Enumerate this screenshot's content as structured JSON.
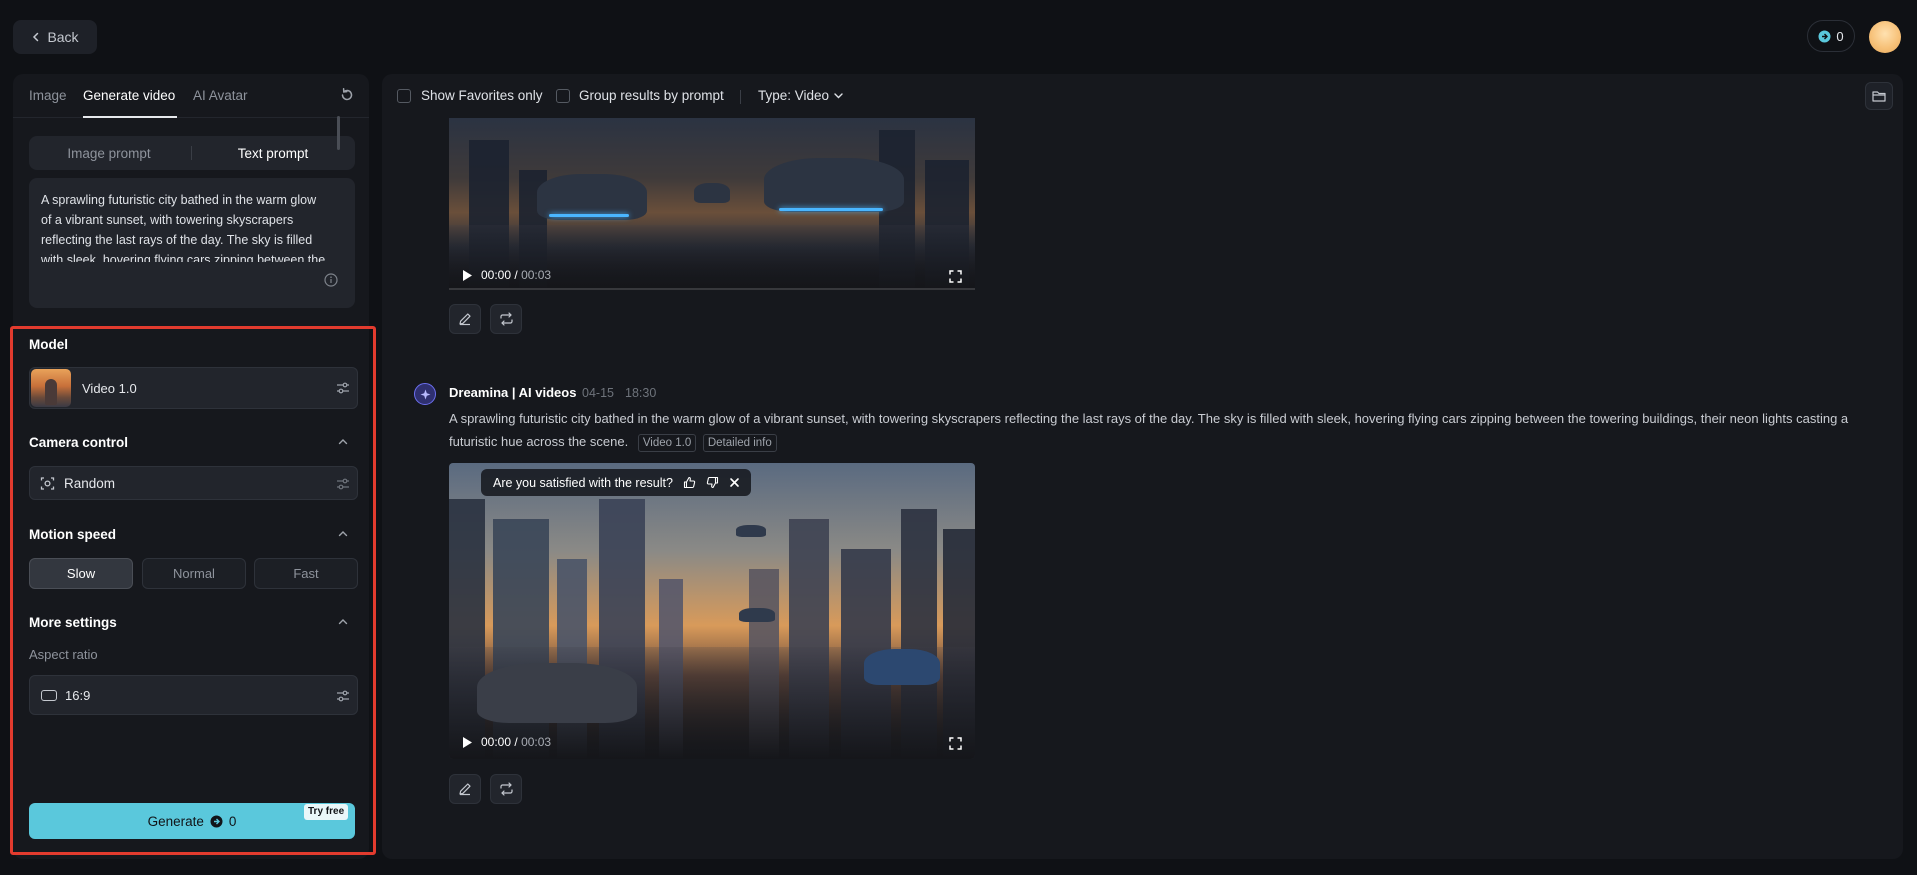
{
  "header": {
    "back_label": "Back",
    "credits": "0"
  },
  "left": {
    "tabs": [
      {
        "label": "Image"
      },
      {
        "label": "Generate video"
      },
      {
        "label": "AI Avatar"
      }
    ],
    "prompt_modes": {
      "image": "Image prompt",
      "text": "Text prompt"
    },
    "prompt_text": "A sprawling futuristic city bathed in the warm glow of a vibrant sunset, with towering skyscrapers reflecting the last rays of the day. The sky is filled with sleek, hovering flying cars zipping between the towering buildings, their neon lights casting a futuristic hue across the scene.",
    "model": {
      "title": "Model",
      "value": "Video 1.0"
    },
    "camera": {
      "title": "Camera control",
      "value": "Random"
    },
    "motion": {
      "title": "Motion speed",
      "options": [
        "Slow",
        "Normal",
        "Fast"
      ],
      "selected": "Slow"
    },
    "more": {
      "title": "More settings",
      "aspect_label": "Aspect ratio",
      "aspect_value": "16:9"
    },
    "generate": {
      "label": "Generate",
      "cost": "0",
      "badge": "Try free"
    }
  },
  "toolbar": {
    "favorites_label": "Show Favorites only",
    "group_label": "Group results by prompt",
    "type_label": "Type: Video"
  },
  "results": {
    "video1": {
      "time_current": "00:00",
      "time_sep": "/",
      "time_total": "00:03"
    },
    "message": {
      "author": "Dreamina | AI videos",
      "date": "04-15",
      "time": "18:30",
      "text": "A sprawling futuristic city bathed in the warm glow of a vibrant sunset, with towering skyscrapers reflecting the last rays of the day. The sky is filled with sleek, hovering flying cars zipping between the towering buildings, their neon lights casting a futuristic hue across the scene.",
      "tag_model": "Video 1.0",
      "tag_info": "Detailed info"
    },
    "video2": {
      "time_current": "00:00",
      "time_sep": "/",
      "time_total": "00:03"
    },
    "feedback_text": "Are you satisfied with the result?"
  },
  "colors": {
    "accent": "#5ac8dc",
    "highlight_border": "#e23b2e",
    "panel": "#16181d",
    "background": "#0f1115"
  }
}
